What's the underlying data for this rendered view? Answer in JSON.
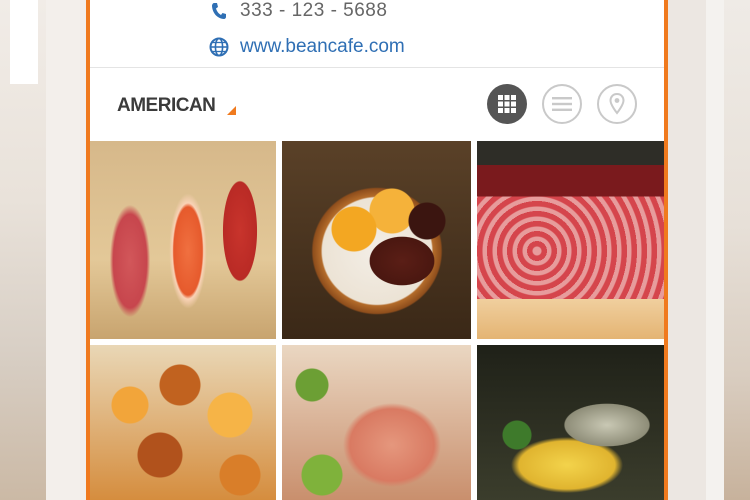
{
  "contact": {
    "phone": "333 - 123 - 5688",
    "website": "www.beancafe.com"
  },
  "category": {
    "label": "AMERICAN"
  },
  "view_toggle": {
    "active": "grid",
    "options": [
      "grid",
      "list",
      "map"
    ]
  },
  "photos": [
    {
      "name": "sushi-photo"
    },
    {
      "name": "eggs-foie-gras-photo"
    },
    {
      "name": "wagyu-beef-photo"
    },
    {
      "name": "roasted-potatoes-photo"
    },
    {
      "name": "rice-pepper-photo"
    },
    {
      "name": "grilled-pasta-photo"
    }
  ],
  "colors": {
    "accent": "#f07a1e",
    "link": "#2f6fb4",
    "active_button": "#555555"
  }
}
